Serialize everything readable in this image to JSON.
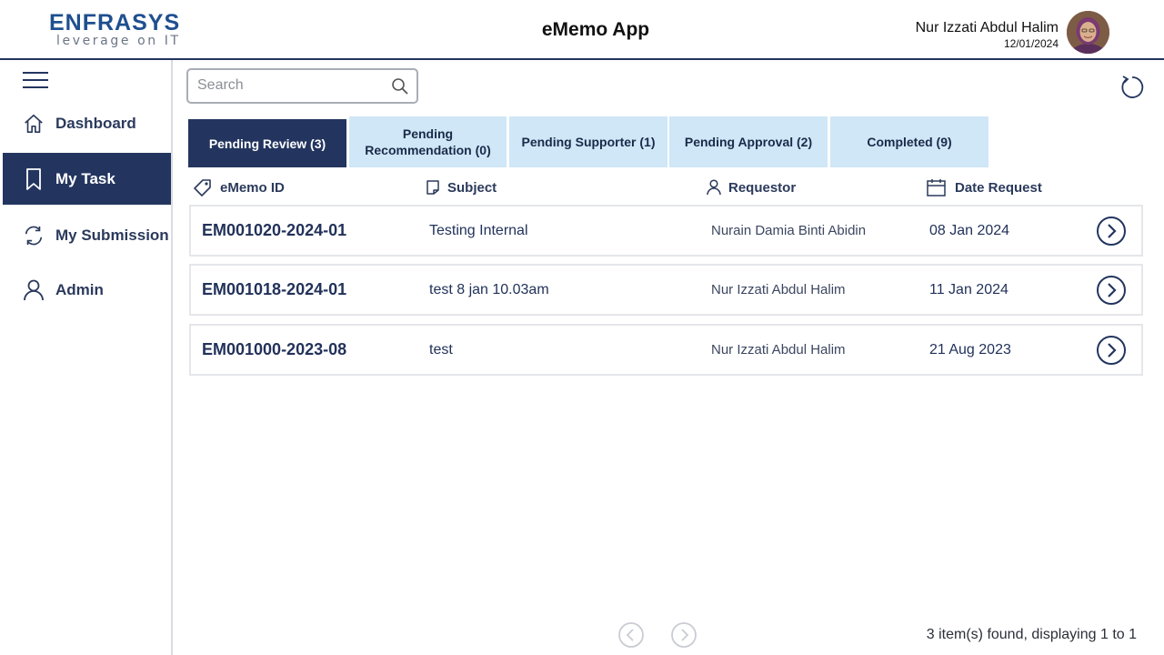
{
  "header": {
    "logo_main": "ENFRASYS",
    "logo_sub": "leverage on IT",
    "app_title": "eMemo App",
    "user_name": "Nur Izzati Abdul Halim",
    "user_date": "12/01/2024"
  },
  "sidebar": {
    "items": [
      {
        "label": "Dashboard",
        "icon": "home-icon",
        "active": false
      },
      {
        "label": "My Task",
        "icon": "bookmark-icon",
        "active": true
      },
      {
        "label": "My Submission",
        "icon": "sync-icon",
        "active": false
      },
      {
        "label": "Admin",
        "icon": "user-icon",
        "active": false
      }
    ]
  },
  "search": {
    "placeholder": "Search",
    "value": ""
  },
  "tabs": [
    {
      "label": "Pending Review (3)",
      "active": true
    },
    {
      "label_line1": "Pending",
      "label_line2": "Recommendation (0)",
      "active": false
    },
    {
      "label": "Pending Supporter (1)",
      "active": false
    },
    {
      "label": "Pending Approval (2)",
      "active": false
    },
    {
      "label": "Completed (9)",
      "active": false
    }
  ],
  "columns": {
    "id": "eMemo ID",
    "subject": "Subject",
    "requestor": "Requestor",
    "date": "Date Request"
  },
  "rows": [
    {
      "id": "EM001020-2024-01",
      "subject": "Testing Internal",
      "requestor": "Nurain Damia Binti Abidin",
      "date": "08 Jan 2024"
    },
    {
      "id": "EM001018-2024-01",
      "subject": "test 8 jan 10.03am",
      "requestor": "Nur Izzati Abdul Halim",
      "date": "11 Jan 2024"
    },
    {
      "id": "EM001000-2023-08",
      "subject": "test",
      "requestor": "Nur Izzati Abdul Halim",
      "date": "21 Aug 2023"
    }
  ],
  "footer": {
    "status": "3 item(s) found, displaying 1 to 1"
  },
  "colors": {
    "primary": "#23355f",
    "tab_inactive": "#cfe7f6",
    "logo_blue": "#1f4f8f"
  }
}
